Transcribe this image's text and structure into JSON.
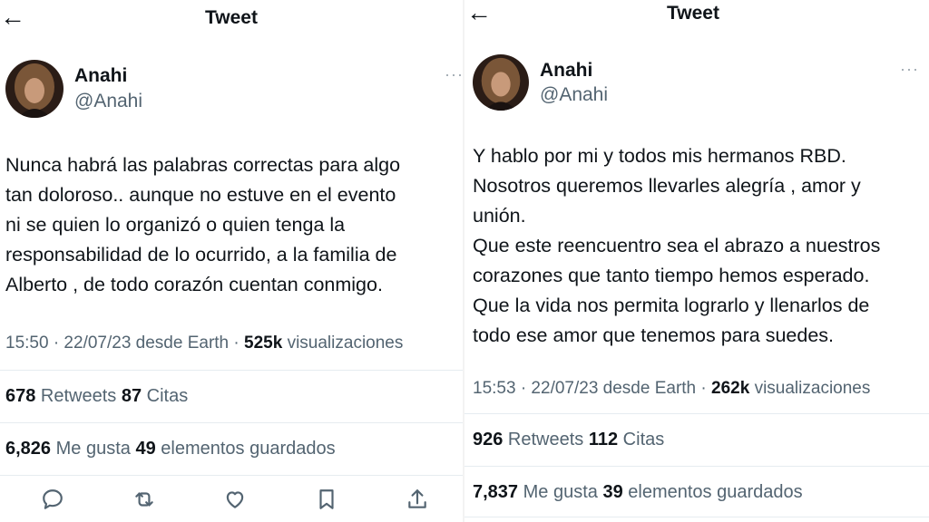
{
  "left": {
    "header": {
      "title": "Tweet"
    },
    "author": {
      "name": "Anahi",
      "handle": "@Anahi"
    },
    "text": "Nunca habrá las palabras correctas para algo\ntan doloroso.. aunque no estuve en el evento\nni se quien lo organizó o quien tenga la\nresponsabilidad de lo ocurrido, a la familia de\nAlberto , de todo corazón cuentan conmigo.",
    "meta": {
      "time": "15:50 · 22/07/23 desde Earth · ",
      "views": "525k",
      "views_label": " visualizaciones"
    },
    "stats": {
      "retweets": "678",
      "retweets_label": " Retweets ",
      "quotes": "87",
      "quotes_label": " Citas",
      "likes": "6,826",
      "likes_label": " Me gusta ",
      "bookmarks": "49",
      "bookmarks_label": " elementos guardados"
    },
    "actions": [
      "reply-icon",
      "retweet-icon",
      "like-icon",
      "bookmark-icon",
      "share-icon"
    ]
  },
  "right": {
    "header": {
      "title": "Tweet"
    },
    "author": {
      "name": "Anahi",
      "handle": "@Anahi"
    },
    "text": "Y hablo por mi y todos mis hermanos RBD.\nNosotros queremos llevarles alegría , amor y\nunión.\nQue este reencuentro sea el abrazo a nuestros\ncorazones que tanto tiempo hemos esperado.\nQue la vida nos permita lograrlo y llenarlos de\ntodo ese amor que tenemos para suedes.",
    "meta": {
      "time": "15:53 · 22/07/23 desde Earth · ",
      "views": "262k",
      "views_label": " visualizaciones"
    },
    "stats": {
      "retweets": "926",
      "retweets_label": " Retweets ",
      "quotes": "112",
      "quotes_label": " Citas",
      "likes": "7,837",
      "likes_label": " Me gusta ",
      "bookmarks": "39",
      "bookmarks_label": " elementos guardados"
    }
  },
  "colors": {
    "text": "#0f1419",
    "secondary": "#536471",
    "divider": "#e6ecf0"
  }
}
